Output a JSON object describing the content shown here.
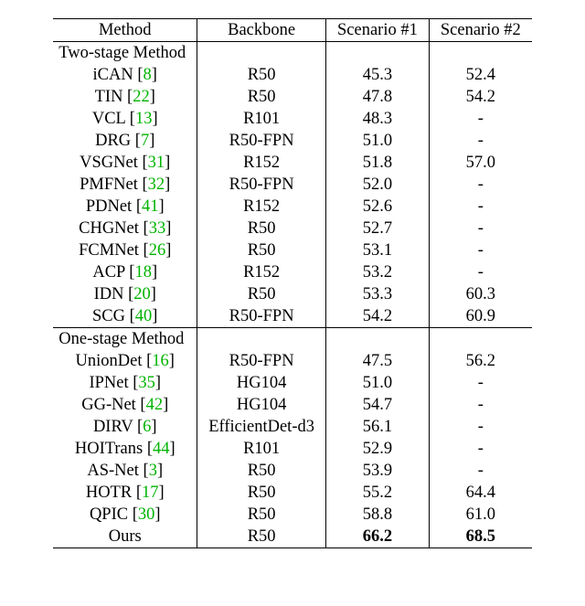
{
  "headers": {
    "method": "Method",
    "backbone": "Backbone",
    "scenario1": "Scenario #1",
    "scenario2": "Scenario #2"
  },
  "sections": [
    {
      "title": "Two-stage Method",
      "rows": [
        {
          "method": "iCAN",
          "cite": "8",
          "backbone": "R50",
          "s1": "45.3",
          "s2": "52.4"
        },
        {
          "method": "TIN",
          "cite": "22",
          "backbone": "R50",
          "s1": "47.8",
          "s2": "54.2"
        },
        {
          "method": "VCL",
          "cite": "13",
          "backbone": "R101",
          "s1": "48.3",
          "s2": "-"
        },
        {
          "method": "DRG",
          "cite": "7",
          "backbone": "R50-FPN",
          "s1": "51.0",
          "s2": "-"
        },
        {
          "method": "VSGNet",
          "cite": "31",
          "backbone": "R152",
          "s1": "51.8",
          "s2": "57.0"
        },
        {
          "method": "PMFNet",
          "cite": "32",
          "backbone": "R50-FPN",
          "s1": "52.0",
          "s2": "-"
        },
        {
          "method": "PDNet",
          "cite": "41",
          "backbone": "R152",
          "s1": "52.6",
          "s2": "-"
        },
        {
          "method": "CHGNet",
          "cite": "33",
          "backbone": "R50",
          "s1": "52.7",
          "s2": "-"
        },
        {
          "method": "FCMNet",
          "cite": "26",
          "backbone": "R50",
          "s1": "53.1",
          "s2": "-"
        },
        {
          "method": "ACP",
          "cite": "18",
          "backbone": "R152",
          "s1": "53.2",
          "s2": "-"
        },
        {
          "method": "IDN",
          "cite": "20",
          "backbone": "R50",
          "s1": "53.3",
          "s2": "60.3"
        },
        {
          "method": "SCG",
          "cite": "40",
          "backbone": "R50-FPN",
          "s1": "54.2",
          "s2": "60.9"
        }
      ]
    },
    {
      "title": "One-stage Method",
      "rows": [
        {
          "method": "UnionDet",
          "cite": "16",
          "backbone": "R50-FPN",
          "s1": "47.5",
          "s2": "56.2"
        },
        {
          "method": "IPNet",
          "cite": "35",
          "backbone": "HG104",
          "s1": "51.0",
          "s2": "-"
        },
        {
          "method": "GG-Net",
          "cite": "42",
          "backbone": "HG104",
          "s1": "54.7",
          "s2": "-"
        },
        {
          "method": "DIRV",
          "cite": "6",
          "backbone": "EfficientDet-d3",
          "s1": "56.1",
          "s2": "-"
        },
        {
          "method": "HOITrans",
          "cite": "44",
          "backbone": "R101",
          "s1": "52.9",
          "s2": "-"
        },
        {
          "method": "AS-Net",
          "cite": "3",
          "backbone": "R50",
          "s1": "53.9",
          "s2": "-"
        },
        {
          "method": "HOTR",
          "cite": "17",
          "backbone": "R50",
          "s1": "55.2",
          "s2": "64.4"
        },
        {
          "method": "QPIC",
          "cite": "30",
          "backbone": "R50",
          "s1": "58.8",
          "s2": "61.0"
        },
        {
          "method": "Ours",
          "cite": "",
          "backbone": "R50",
          "s1": "66.2",
          "s2": "68.5",
          "bold_s": true
        }
      ]
    }
  ],
  "chart_data": {
    "type": "table",
    "title": "Comparison of HOI detection methods",
    "columns": [
      "Method",
      "Backbone",
      "Scenario #1",
      "Scenario #2"
    ],
    "two_stage_methods": [
      [
        "iCAN [8]",
        "R50",
        45.3,
        52.4
      ],
      [
        "TIN [22]",
        "R50",
        47.8,
        54.2
      ],
      [
        "VCL [13]",
        "R101",
        48.3,
        null
      ],
      [
        "DRG [7]",
        "R50-FPN",
        51.0,
        null
      ],
      [
        "VSGNet [31]",
        "R152",
        51.8,
        57.0
      ],
      [
        "PMFNet [32]",
        "R50-FPN",
        52.0,
        null
      ],
      [
        "PDNet [41]",
        "R152",
        52.6,
        null
      ],
      [
        "CHGNet [33]",
        "R50",
        52.7,
        null
      ],
      [
        "FCMNet [26]",
        "R50",
        53.1,
        null
      ],
      [
        "ACP [18]",
        "R152",
        53.2,
        null
      ],
      [
        "IDN [20]",
        "R50",
        53.3,
        60.3
      ],
      [
        "SCG [40]",
        "R50-FPN",
        54.2,
        60.9
      ]
    ],
    "one_stage_methods": [
      [
        "UnionDet [16]",
        "R50-FPN",
        47.5,
        56.2
      ],
      [
        "IPNet [35]",
        "HG104",
        51.0,
        null
      ],
      [
        "GG-Net [42]",
        "HG104",
        54.7,
        null
      ],
      [
        "DIRV [6]",
        "EfficientDet-d3",
        56.1,
        null
      ],
      [
        "HOITrans [44]",
        "R101",
        52.9,
        null
      ],
      [
        "AS-Net [3]",
        "R50",
        53.9,
        null
      ],
      [
        "HOTR [17]",
        "R50",
        55.2,
        64.4
      ],
      [
        "QPIC [30]",
        "R50",
        58.8,
        61.0
      ],
      [
        "Ours",
        "R50",
        66.2,
        68.5
      ]
    ]
  }
}
